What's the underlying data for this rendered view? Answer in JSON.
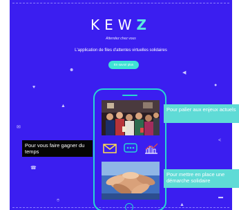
{
  "brand": {
    "logo_left": "KEW",
    "logo_right": "Z"
  },
  "hero": {
    "tagline": "Attendez chez vous",
    "subtitle": "L'application de files d'attentes virtuelles solidaires",
    "cta_label": "En savoir plus"
  },
  "callouts": {
    "right_top": "Pour palier aux enjeux actuels",
    "left_middle": "Pour vous faire gagner du temps",
    "right_bottom": "Pour mettre en place une démarche solidaire"
  },
  "icons": [
    "heart-icon",
    "smile-icon",
    "megaphone-icon",
    "user-icon",
    "bell-icon",
    "mail-icon",
    "share-icon",
    "phone-icon",
    "location-icon",
    "chat-icon",
    "bars-chart-icon"
  ],
  "colors": {
    "banner": "#3b1ef0",
    "accent": "#3fe3d4",
    "phone_frame": "#27d7d2",
    "callout_teal": "#5fdbd6",
    "callout_dark": "#050505"
  }
}
